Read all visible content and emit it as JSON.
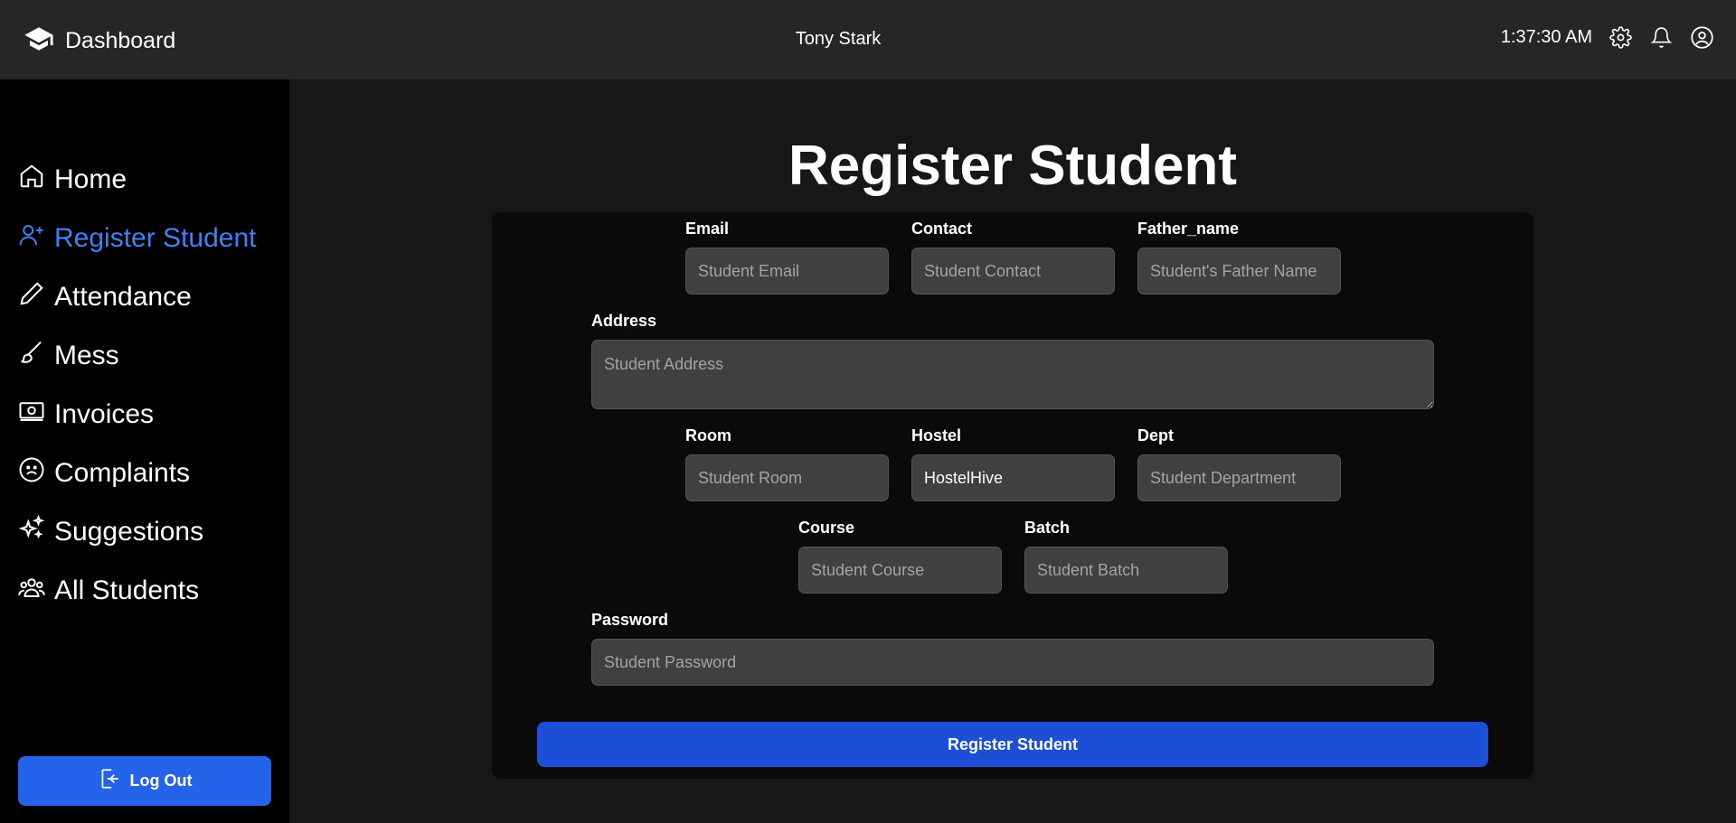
{
  "header": {
    "brand": "Dashboard",
    "user_name": "Tony Stark",
    "time": "1:37:30 AM",
    "icons": [
      "graduation-cap-icon",
      "gear-icon",
      "bell-icon",
      "user-circle-icon"
    ]
  },
  "sidebar": {
    "items": [
      {
        "label": "Home",
        "icon": "home-icon"
      },
      {
        "label": "Register Student",
        "icon": "user-plus-icon",
        "active": true
      },
      {
        "label": "Attendance",
        "icon": "pencil-icon"
      },
      {
        "label": "Mess",
        "icon": "brush-icon"
      },
      {
        "label": "Invoices",
        "icon": "money-icon"
      },
      {
        "label": "Complaints",
        "icon": "frown-icon"
      },
      {
        "label": "Suggestions",
        "icon": "sparkles-icon"
      },
      {
        "label": "All Students",
        "icon": "users-icon"
      }
    ],
    "logout_label": "Log Out"
  },
  "main": {
    "title": "Register Student",
    "form": {
      "email": {
        "label": "Email",
        "placeholder": "Student Email",
        "value": ""
      },
      "contact": {
        "label": "Contact",
        "placeholder": "Student Contact",
        "value": ""
      },
      "father_name": {
        "label": "Father_name",
        "placeholder": "Student's Father Name",
        "value": ""
      },
      "address": {
        "label": "Address",
        "placeholder": "Student Address",
        "value": ""
      },
      "room": {
        "label": "Room",
        "placeholder": "Student Room",
        "value": ""
      },
      "hostel": {
        "label": "Hostel",
        "placeholder": "",
        "value": "HostelHive"
      },
      "dept": {
        "label": "Dept",
        "placeholder": "Student Department",
        "value": ""
      },
      "course": {
        "label": "Course",
        "placeholder": "Student Course",
        "value": ""
      },
      "batch": {
        "label": "Batch",
        "placeholder": "Student Batch",
        "value": ""
      },
      "password": {
        "label": "Password",
        "placeholder": "Student Password",
        "value": ""
      },
      "submit_label": "Register Student"
    }
  },
  "colors": {
    "accent": "#3b82f6",
    "button": "#1d4ed8",
    "logout": "#2563eb"
  }
}
